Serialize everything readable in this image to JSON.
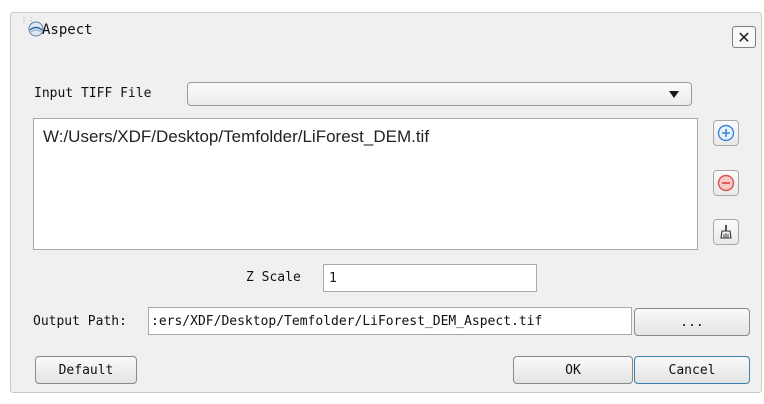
{
  "window": {
    "title": "Aspect",
    "close_glyph": "✕"
  },
  "icons": [
    "app-logo-icon",
    "close-icon",
    "add-icon",
    "remove-icon",
    "clear-icon",
    "dropdown-arrow-icon"
  ],
  "colors": {
    "add_accent": "#3b86d6",
    "remove_accent": "#d9534f",
    "dialog_bg": "#f0f0f0"
  },
  "input_file": {
    "label": "Input TIFF File",
    "selected": ""
  },
  "file_list": {
    "items": [
      "W:/Users/XDF/Desktop/Temfolder/LiForest_DEM.tif"
    ]
  },
  "z_scale": {
    "label": "Z Scale",
    "value": "1"
  },
  "output": {
    "label": "Output Path:",
    "value": ":ers/XDF/Desktop/Temfolder/LiForest_DEM_Aspect.tif",
    "browse_label": "..."
  },
  "buttons": {
    "default": "Default",
    "ok": "OK",
    "cancel": "Cancel"
  }
}
